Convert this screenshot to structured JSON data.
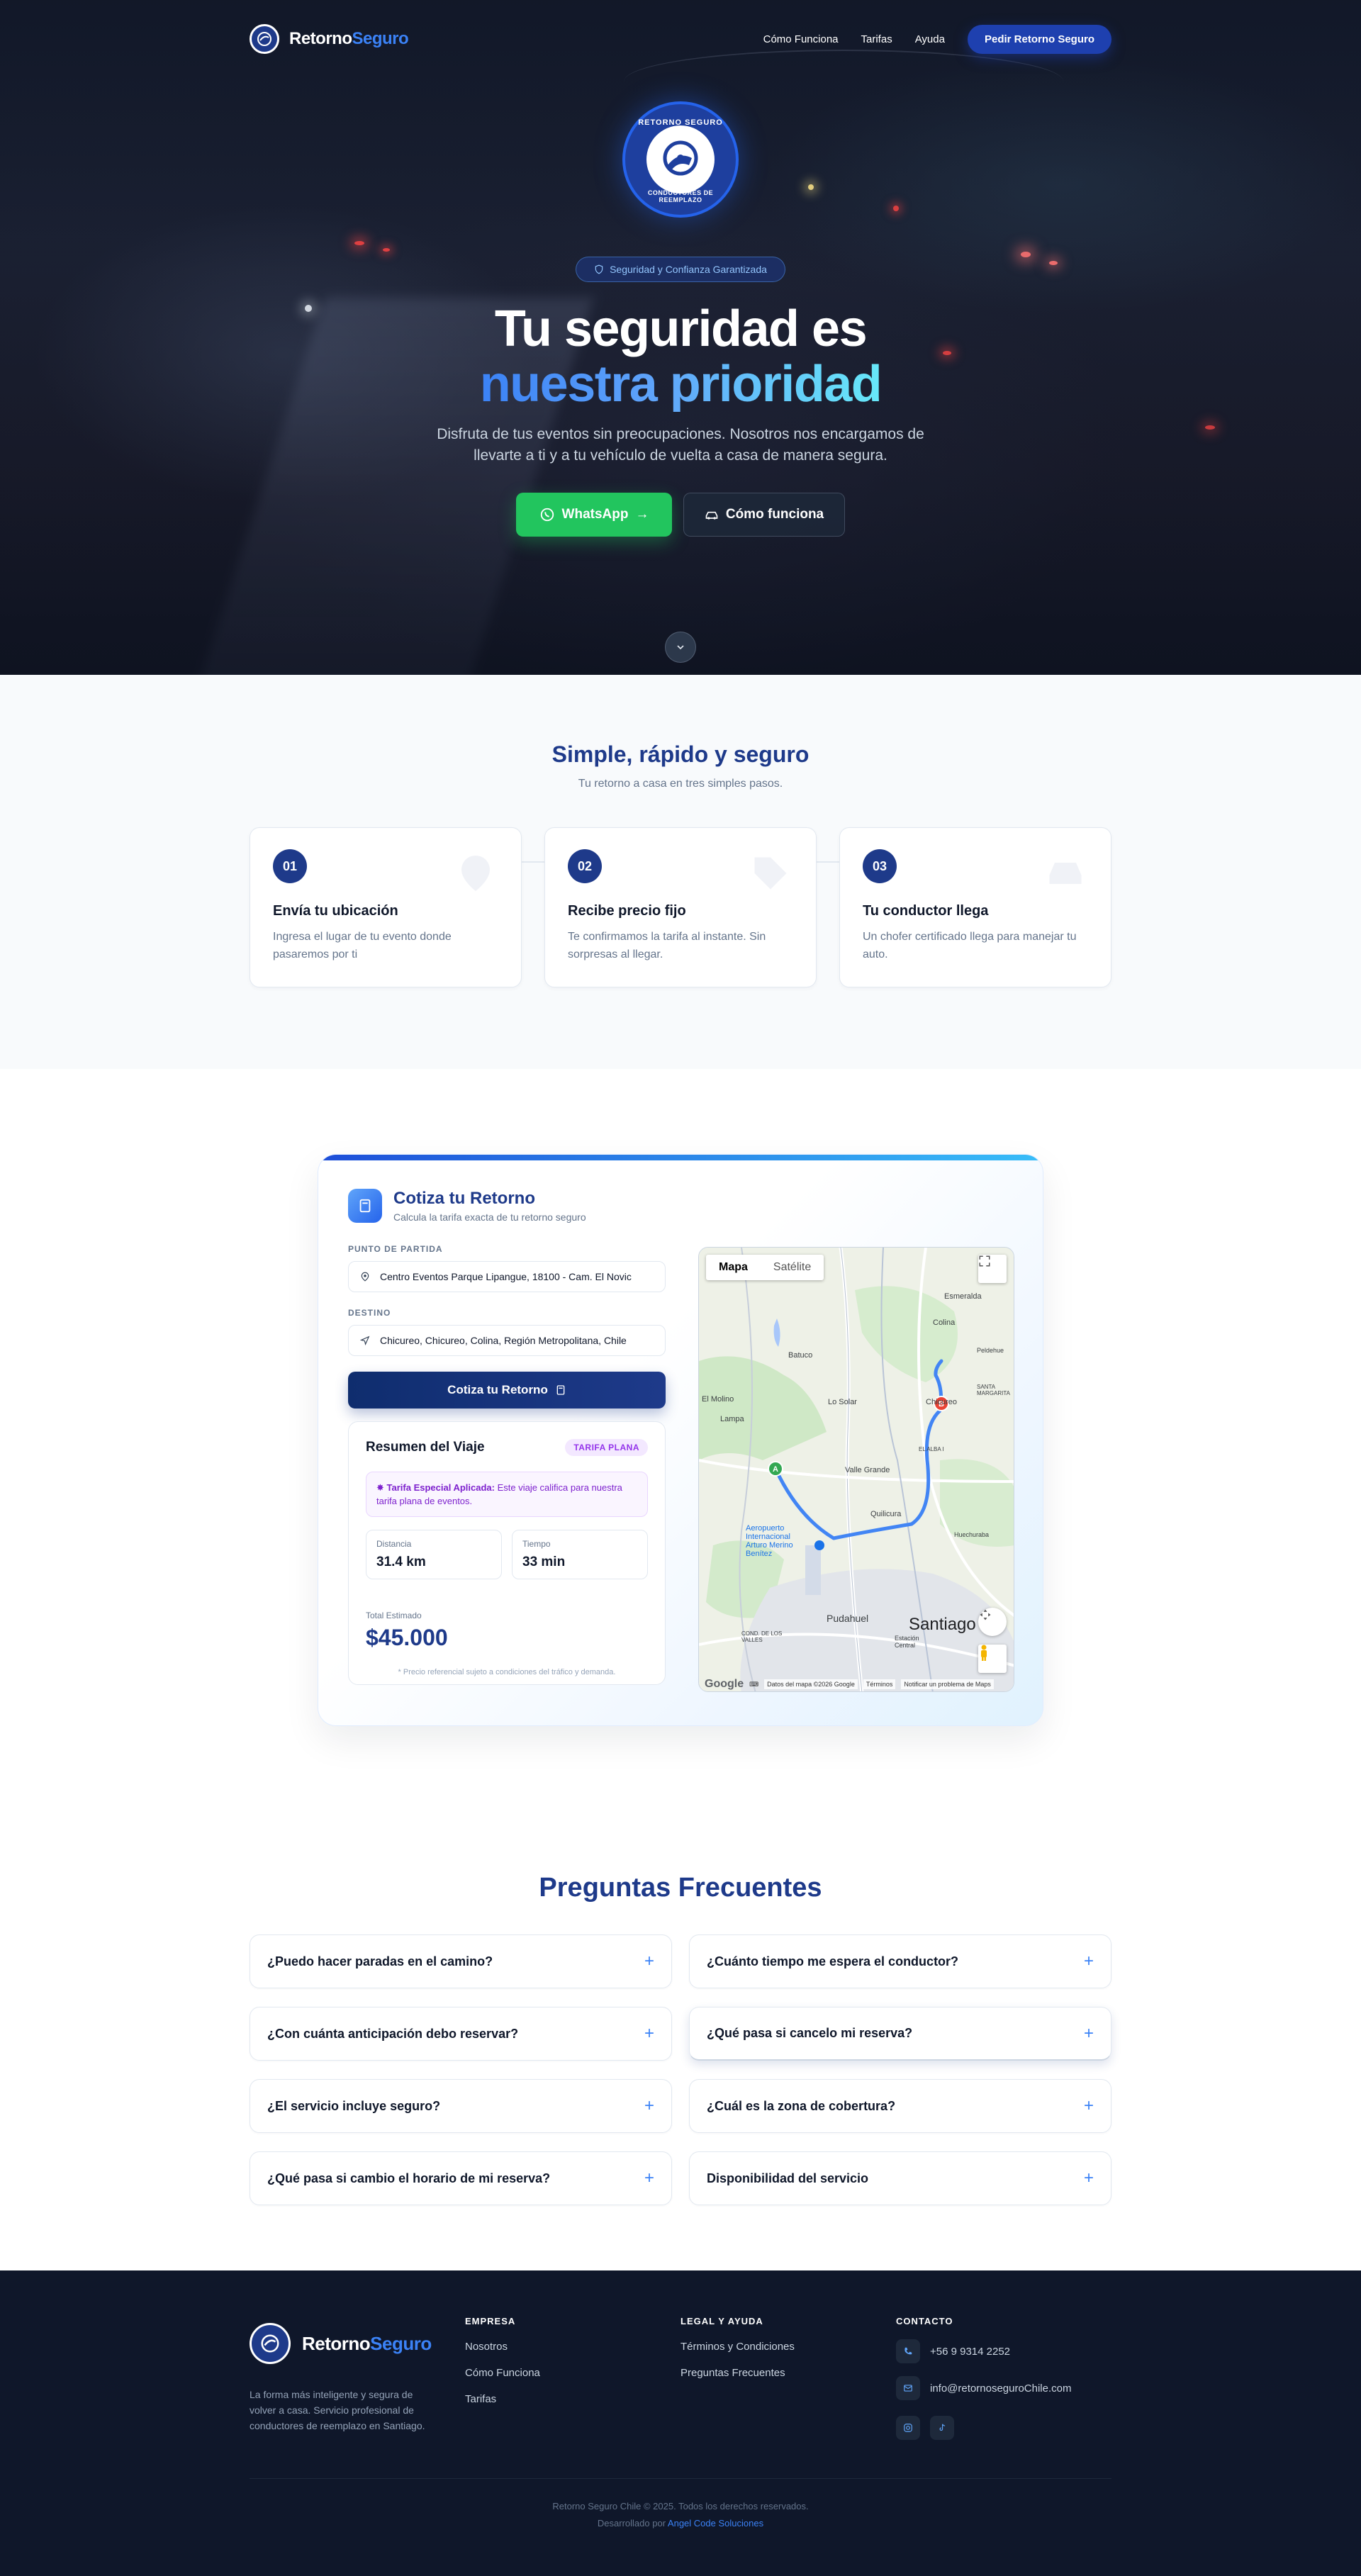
{
  "nav": {
    "brand_main": "Retorno",
    "brand_accent": "Seguro",
    "links": [
      "Cómo Funciona",
      "Tarifas",
      "Ayuda"
    ],
    "cta": "Pedir Retorno Seguro"
  },
  "hero": {
    "logo_top_text": "RETORNO SEGURO",
    "logo_bottom_text": "CONDUCTORES DE REEMPLAZO",
    "badge": "Seguridad y Confianza Garantizada",
    "title_line1": "Tu seguridad es",
    "title_line2": "nuestra prioridad",
    "subtitle": "Disfruta de tus eventos sin preocupaciones. Nosotros nos encargamos de llevarte a ti y a tu vehículo de vuelta a casa de manera segura.",
    "btn_whatsapp": "WhatsApp",
    "btn_how": "Cómo funciona"
  },
  "steps": {
    "title": "Simple, rápido y seguro",
    "subtitle": "Tu retorno a casa en tres simples pasos.",
    "items": [
      {
        "num": "01",
        "title": "Envía tu ubicación",
        "text": "Ingresa el lugar de tu evento donde pasaremos por ti"
      },
      {
        "num": "02",
        "title": "Recibe precio fijo",
        "text": "Te confirmamos la tarifa al instante. Sin sorpresas al llegar."
      },
      {
        "num": "03",
        "title": "Tu conductor llega",
        "text": "Un chofer certificado llega para manejar tu auto."
      }
    ]
  },
  "quote": {
    "title": "Cotiza tu Retorno",
    "subtitle": "Calcula la tarifa exacta de tu retorno seguro",
    "origin_label": "PUNTO DE PARTIDA",
    "origin_value": "Centro Eventos Parque Lipangue, 18100 - Cam. El Novic",
    "dest_label": "DESTINO",
    "dest_value": "Chicureo, Chicureo, Colina, Región Metropolitana, Chile",
    "submit": "Cotiza tu Retorno",
    "summary": {
      "title": "Resumen del Viaje",
      "pill": "TARIFA PLANA",
      "note_bold": "Tarifa Especial Aplicada:",
      "note_text": " Este viaje califica para nuestra tarifa plana de eventos.",
      "distance_label": "Distancia",
      "distance_value": "31.4 km",
      "time_label": "Tiempo",
      "time_value": "33 min",
      "total_label": "Total Estimado",
      "total_value": "$45.000",
      "footnote": "* Precio referencial sujeto a condiciones del tráfico y demanda."
    },
    "map": {
      "tab_map": "Mapa",
      "tab_sat": "Satélite",
      "labels": {
        "esmeralda": "Esmeralda",
        "colina": "Colina",
        "batuco": "Batuco",
        "el_molino": "El Molino",
        "lo_solar": "Lo Solar",
        "chicureo": "Chicureo",
        "santa_margarita": "SANTA MARGARITA",
        "lampa": "Lampa",
        "el_alba": "EL ALBA I",
        "valle_grande": "Valle Grande",
        "quilicura": "Quilicura",
        "aeropuerto": "Aeropuerto Internacional Arturo Merino Benítez",
        "huechuraba": "Huechuraba",
        "pudahuel": "Pudahuel",
        "santiago": "Santiago",
        "estacion": "Estación Central",
        "cond_valles": "COND. DE LOS VALLES",
        "peldehue": "Peldehue"
      },
      "marker_a": "A",
      "marker_b": "B",
      "google": "Google",
      "data": "Datos del mapa ©2026 Google",
      "terms": "Términos",
      "report": "Notificar un problema de Maps"
    }
  },
  "faq": {
    "title": "Preguntas Frecuentes",
    "items": [
      "¿Puedo hacer paradas en el camino?",
      "¿Cuánto tiempo me espera el conductor?",
      "¿Con cuánta anticipación debo reservar?",
      "¿Qué pasa si cancelo mi reserva?",
      "¿El servicio incluye seguro?",
      "¿Cuál es la zona de cobertura?",
      "¿Qué pasa si cambio el horario de mi reserva?",
      "Disponibilidad del servicio"
    ]
  },
  "footer": {
    "brand_main": "Retorno",
    "brand_accent": "Seguro",
    "description": "La forma más inteligente y segura de volver a casa. Servicio profesional de conductores de reemplazo en Santiago.",
    "company_head": "EMPRESA",
    "company_links": [
      "Nosotros",
      "Cómo Funciona",
      "Tarifas"
    ],
    "legal_head": "LEGAL Y AYUDA",
    "legal_links": [
      "Términos y Condiciones",
      "Preguntas Frecuentes"
    ],
    "contact_head": "CONTACTO",
    "phone": "+56 9 9314 2252",
    "email": "info@retornoseguroChile.com",
    "copyright": "Retorno Seguro Chile © 2025. Todos los derechos reservados.",
    "dev_prefix": "Desarrollado por ",
    "dev_name": "Angel Code Soluciones"
  },
  "colors": {
    "primary": "#1e3a8a",
    "accent": "#3b82f6",
    "whatsapp": "#22c55e",
    "footer_bg": "#0f172a",
    "route": "#4285f4"
  }
}
